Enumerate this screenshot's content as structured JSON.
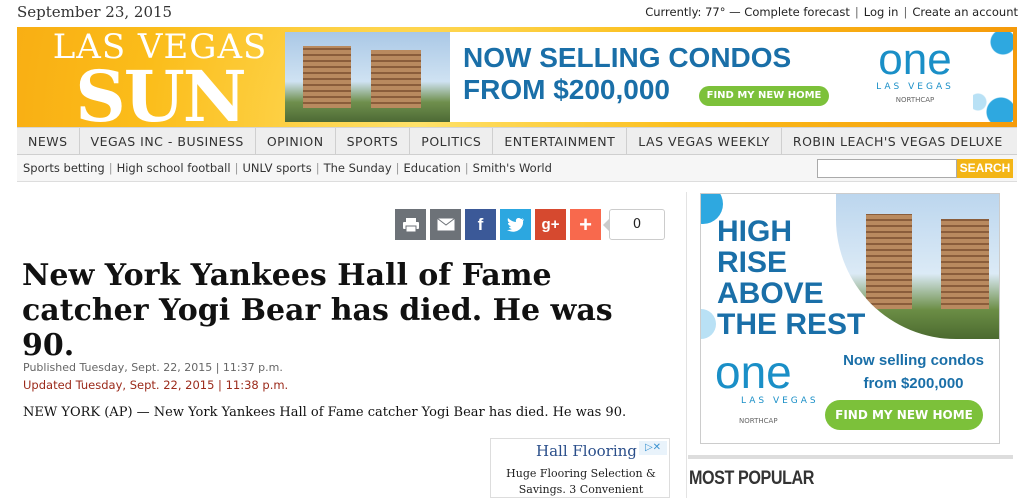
{
  "top": {
    "date": "September 23, 2015",
    "weather": "Currently: 77° — Complete forecast",
    "login": "Log in",
    "create": "Create an account"
  },
  "logo": {
    "line1": "LAS VEGAS",
    "line2": "SUN"
  },
  "banner": {
    "headline1": "NOW SELLING CONDOS",
    "headline2": "FROM $200,000",
    "cta": "FIND MY NEW HOME",
    "brand": "one",
    "brand_sub": "LAS VEGAS",
    "brand_partner": "NORTHCAP"
  },
  "nav": {
    "items": [
      "NEWS",
      "VEGAS INC - BUSINESS",
      "OPINION",
      "SPORTS",
      "POLITICS",
      "ENTERTAINMENT",
      "LAS VEGAS WEEKLY",
      "ROBIN LEACH'S VEGAS DELUXE"
    ]
  },
  "subnav": {
    "items": [
      "Sports betting",
      "High school football",
      "UNLV sports",
      "The Sunday",
      "Education",
      "Smith's World"
    ],
    "search_label": "SEARCH",
    "search_placeholder": ""
  },
  "share": {
    "icons": [
      "print-icon",
      "email-icon",
      "facebook-icon",
      "twitter-icon",
      "googleplus-icon",
      "addthis-icon"
    ],
    "count": "0"
  },
  "article": {
    "title": "New York Yankees Hall of Fame catcher Yogi Bear has died. He was 90.",
    "published": "Published Tuesday, Sept. 22, 2015 | 11:37 p.m.",
    "updated": "Updated Tuesday, Sept. 22, 2015 | 11:38 p.m.",
    "body": "NEW YORK (AP) — New York Yankees Hall of Fame catcher Yogi Bear has died. He was 90."
  },
  "inline_ad": {
    "title": "Hall Flooring",
    "desc1": "Huge Flooring Selection &",
    "desc2": "Savings. 3 Convenient"
  },
  "side_ad": {
    "line1": "HIGH",
    "line2": "RISE",
    "line3": "ABOVE",
    "line4": "THE REST",
    "brand": "one",
    "brand_sub": "LAS VEGAS",
    "brand_partner": "NORTHCAP",
    "sell1": "Now selling condos",
    "sell2": "from $200,000",
    "cta": "FIND MY NEW HOME"
  },
  "most_popular": "MOST POPULAR",
  "colors": {
    "brand_blue": "#1a6fa8",
    "cta_green": "#7cc13a",
    "sun_orange": "#f59a0a",
    "updated_red": "#9b2a1a"
  }
}
